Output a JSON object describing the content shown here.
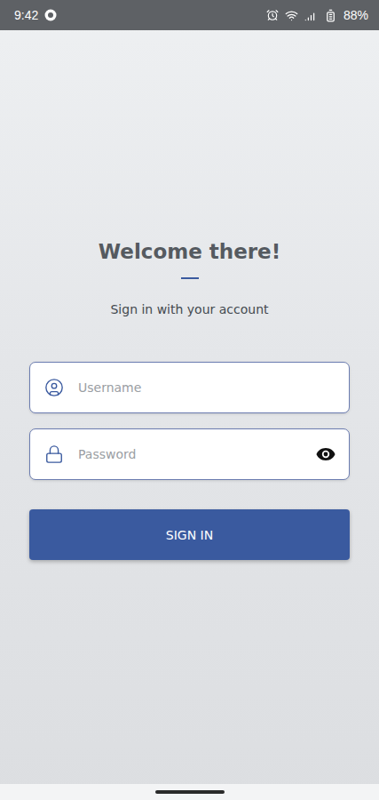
{
  "status_bar": {
    "time": "9:42",
    "battery": "88%"
  },
  "heading": {
    "title": "Welcome there!",
    "subtitle": "Sign in with your account"
  },
  "fields": [
    {
      "name": "username",
      "placeholder": "Username",
      "kind": "text"
    },
    {
      "name": "password",
      "placeholder": "Password",
      "kind": "password"
    }
  ],
  "button": {
    "label": "SIGN IN"
  }
}
